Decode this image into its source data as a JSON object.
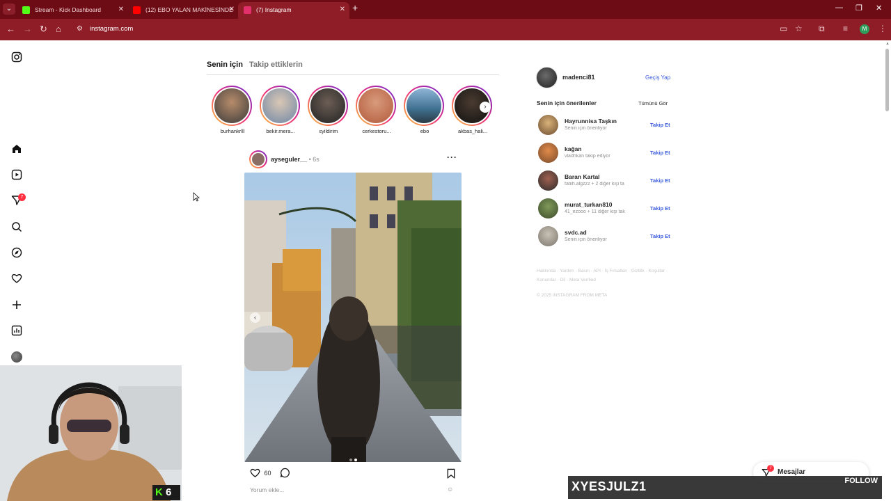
{
  "browser": {
    "tabs": [
      {
        "title": "Stream - Kick Dashboard",
        "favicon_color": "#53fc18"
      },
      {
        "title": "(12) EBO YALAN MAKİNESİNDE",
        "favicon_color": "#ff0000"
      },
      {
        "title": "(7) Instagram",
        "favicon_color": "#e1306c"
      }
    ],
    "url": "instagram.com",
    "profile_initial": "M",
    "theme_color": "#8f1d27"
  },
  "sidebar": {
    "notification_count": "7",
    "icons": [
      "instagram-icon",
      "home-icon",
      "reels-icon",
      "messages-icon",
      "search-icon",
      "explore-icon",
      "heart-icon",
      "create-icon",
      "dashboard-icon"
    ]
  },
  "feed": {
    "tabs": [
      "Senin için",
      "Takip ettiklerin"
    ],
    "stories": [
      "burhankrlll",
      "bekir.mera...",
      "ɛyildirim",
      "cerkestoru...",
      "ebo",
      "akbas_hali..."
    ],
    "post": {
      "username": "ayseguler__",
      "separator": "•",
      "time": "6s",
      "likes": "60",
      "comment_placeholder": "Yorum ekle..."
    }
  },
  "right": {
    "username": "madenci81",
    "switch_label": "Geçiş Yap",
    "suggestions_title": "Senin için önerilenler",
    "see_all": "Tümünü Gör",
    "follow_label": "Takip Et",
    "suggestions": [
      {
        "name": "Hayrunnisa Taşkın",
        "sub": "Senin için öneriliyor"
      },
      {
        "name": "kağan",
        "sub": "vladhkan takip ediyor"
      },
      {
        "name": "Baran Kartal",
        "sub": "fatiih.algzzz + 2 diğer kişi ta"
      },
      {
        "name": "murat_turkan810",
        "sub": "41_ezooo + 11 diğer kişi tak"
      },
      {
        "name": "svdc.ad",
        "sub": "Senin için öneriliyor"
      }
    ],
    "footer": "Hakkında · Yardım · Basın · API · İş Fırsatları · Gizlilik · Koşullar · Konumlar · Dil · Meta Verified",
    "copyright": "© 2025 INSTAGRAM FROM META"
  },
  "messages": {
    "label": "Mesajlar",
    "badge": "7"
  },
  "stream": {
    "viewer_count": "6",
    "follower_name": "XYESJULZ1",
    "follow_label": "FOLLOW"
  }
}
